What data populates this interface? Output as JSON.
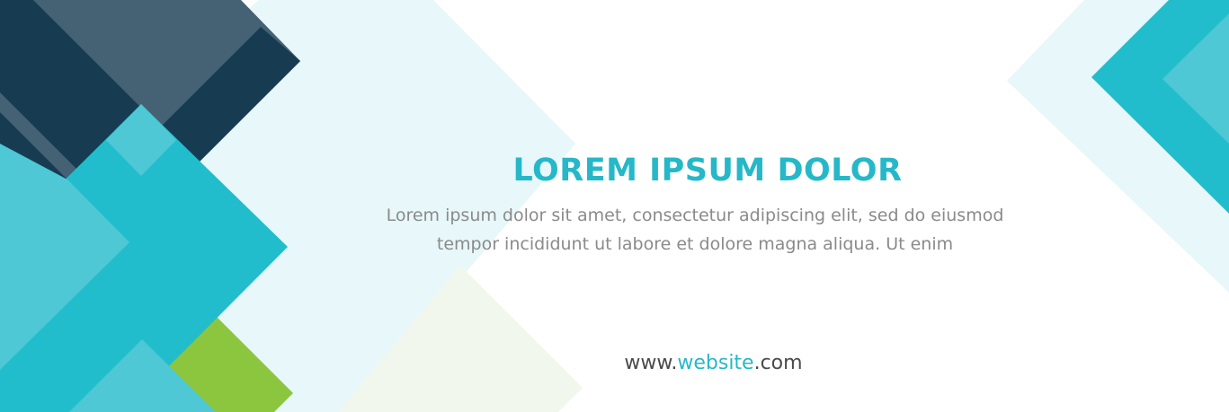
{
  "banner": {
    "title": "LOREM IPSUM DOLOR",
    "body_lines": [
      "Lorem ipsum dolor sit amet, consectetur adipiscing elit, sed do eiusmod",
      "tempor incididunt ut labore et dolore magna aliqua. Ut enim"
    ],
    "website": {
      "prefix": "www.",
      "domain": "website",
      "suffix": ".com"
    }
  },
  "colors": {
    "navy": "#173c52",
    "slate": "#446274",
    "teal": "#22bdcc",
    "light_teal": "#4ec8d4",
    "pale_teal": "#e7f7fa",
    "green": "#8cc63f",
    "light_green": "#a6d05f",
    "pale_green": "#f1f7ec",
    "title": "#26b8c8",
    "body_text": "#8a8a8a",
    "website_text": "#4a4a4a"
  }
}
